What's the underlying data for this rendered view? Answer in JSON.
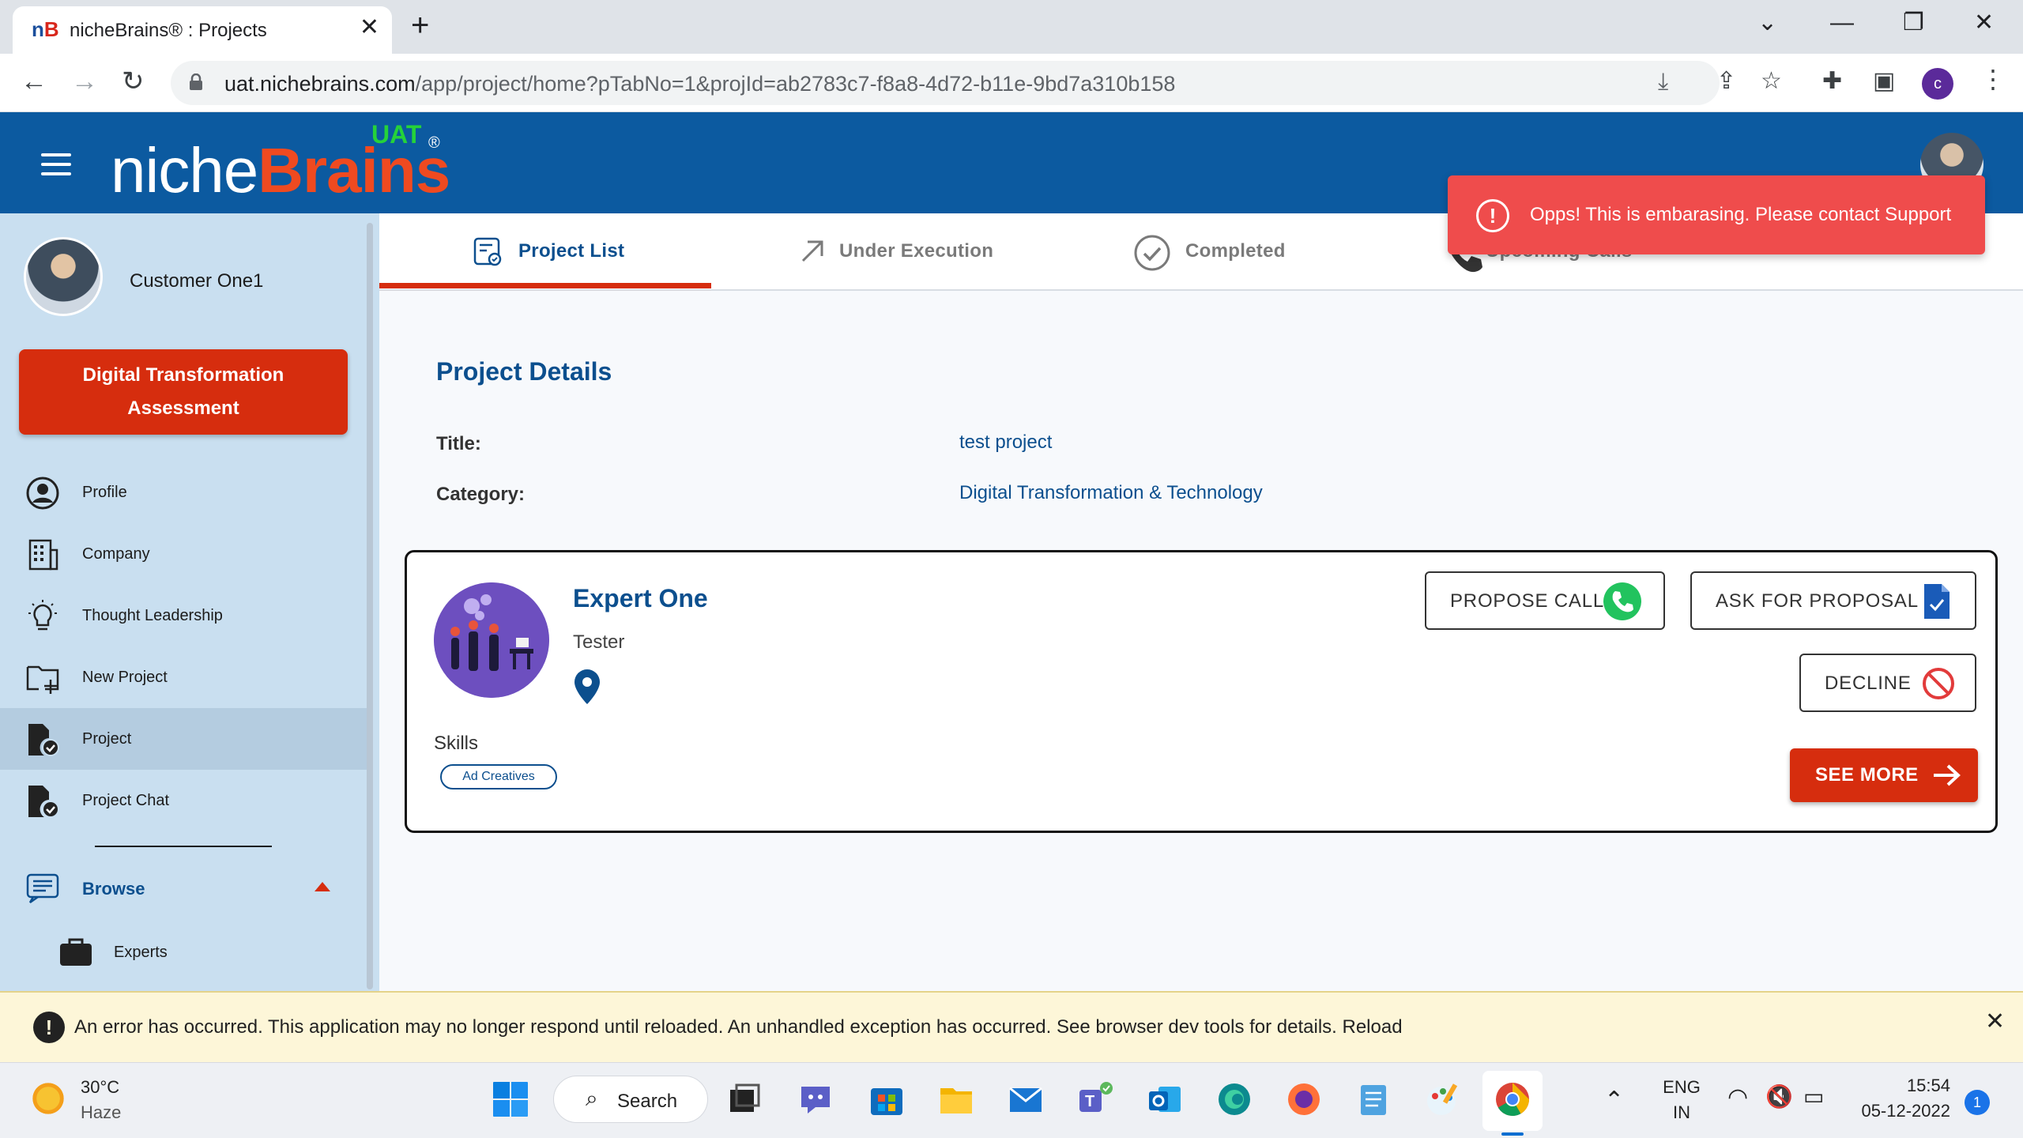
{
  "browser": {
    "tab_title": "nicheBrains® : Projects",
    "tab_favicon": "nB",
    "url_host": "uat.nichebrains.com",
    "url_path": "/app/project/home?pTabNo=1&projId=ab2783c7-f8a8-4d72-b11e-9bd7a310b158",
    "profile_initial": "c",
    "icons": [
      "back-arrow-icon",
      "forward-arrow-icon",
      "reload-icon",
      "lock-icon",
      "install-icon",
      "share-icon",
      "star-icon",
      "extensions-icon",
      "side-panel-icon",
      "menu-kebab-icon"
    ]
  },
  "header": {
    "logo_niche": "niche",
    "logo_brains": "Brains",
    "logo_badge": "UAT",
    "logo_reg": "®",
    "brand_color": "#0c5aa0",
    "accent_color": "#ef4a20"
  },
  "toast": {
    "message": "Opps! This is embarasing. Please contact Support",
    "icon": "!",
    "color": "#ef4c4c"
  },
  "sidebar": {
    "user_name": "Customer One1",
    "dta_button_line1": "Digital Transformation",
    "dta_button_line2": "Assessment",
    "items": [
      {
        "label": "Profile",
        "icon": "user-circle-icon"
      },
      {
        "label": "Company",
        "icon": "building-icon"
      },
      {
        "label": "Thought Leadership",
        "icon": "lightbulb-icon"
      },
      {
        "label": "New Project",
        "icon": "folder-plus-icon"
      },
      {
        "label": "Project",
        "icon": "file-check-icon",
        "active": true
      },
      {
        "label": "Project Chat",
        "icon": "file-check-icon"
      }
    ],
    "browse_label": "Browse",
    "browse_sub": [
      {
        "label": "Experts",
        "icon": "briefcase-icon"
      }
    ]
  },
  "tabs": [
    {
      "label": "Project List",
      "icon": "project-list-icon",
      "active": true
    },
    {
      "label": "Under Execution",
      "icon": "arrow-up-right-icon"
    },
    {
      "label": "Completed",
      "icon": "check-circle-icon"
    },
    {
      "label": "Upcoming Calls",
      "icon": "phone-icon"
    }
  ],
  "project": {
    "section_title": "Project Details",
    "title_label": "Title:",
    "title_value": "test project",
    "category_label": "Category:",
    "category_value": "Digital Transformation & Technology"
  },
  "expert": {
    "name": "Expert One",
    "role": "Tester",
    "skills_label": "Skills",
    "skills": [
      "Ad Creatives"
    ],
    "propose_call": "PROPOSE CALL",
    "ask_proposal": "ASK FOR PROPOSAL",
    "decline": "DECLINE",
    "see_more": "SEE MORE"
  },
  "error_bar": {
    "message": "An error has occurred. This application may no longer respond until reloaded. An unhandled exception has occurred. See browser dev tools for details. Reload",
    "icon": "!"
  },
  "taskbar": {
    "temperature": "30°C",
    "weather": "Haze",
    "search_label": "Search",
    "language_line1": "ENG",
    "language_line2": "IN",
    "time": "15:54",
    "date": "05-12-2022",
    "notification_count": "1",
    "apps": [
      "windows-start-icon",
      "search-icon",
      "task-view-icon",
      "chat-icon",
      "store-icon",
      "file-explorer-icon",
      "mail-icon",
      "teams-icon",
      "outlook-icon",
      "edge-icon",
      "firefox-icon",
      "notepad-icon",
      "paint-icon",
      "chrome-icon"
    ]
  }
}
